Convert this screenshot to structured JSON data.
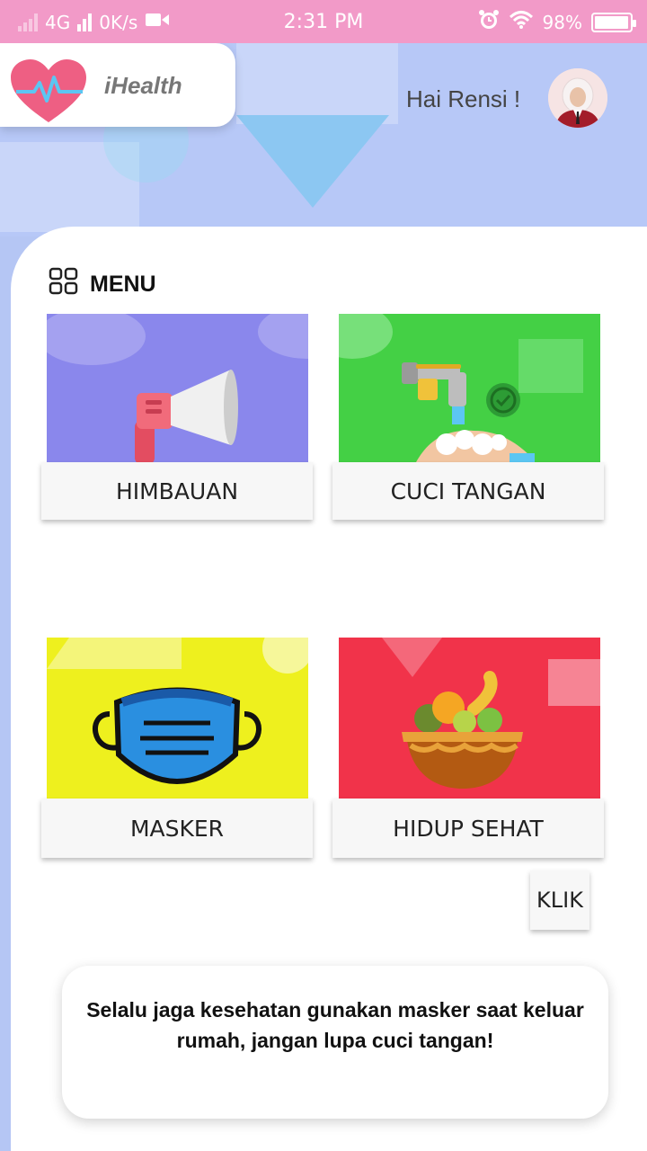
{
  "status_bar": {
    "network": "4G",
    "speed": "0K/s",
    "time": "2:31 PM",
    "battery": "98%",
    "battery_level": 0.98,
    "icons": [
      "signal-icon",
      "video-icon",
      "alarm-icon",
      "wifi-icon",
      "battery-icon"
    ]
  },
  "header": {
    "app_name": "iHealth",
    "greeting": "Hai Rensi !",
    "colors": {
      "header_bg": "#b7c8f7",
      "status_bg": "#f29ac8"
    }
  },
  "menu": {
    "title": "MENU",
    "items": [
      {
        "label": "HIMBAUAN",
        "icon": "megaphone-icon",
        "color": "#8a87ec"
      },
      {
        "label": "CUCI TANGAN",
        "icon": "handwash-icon",
        "color": "#44d045"
      },
      {
        "label": "MASKER",
        "icon": "mask-icon",
        "color": "#eef01e"
      },
      {
        "label": "HIDUP SEHAT",
        "icon": "fruit-basket-icon",
        "color": "#f1334a"
      }
    ]
  },
  "klik_button": "KLIK",
  "message": "Selalu jaga kesehatan gunakan masker saat keluar rumah, jangan lupa cuci tangan!"
}
